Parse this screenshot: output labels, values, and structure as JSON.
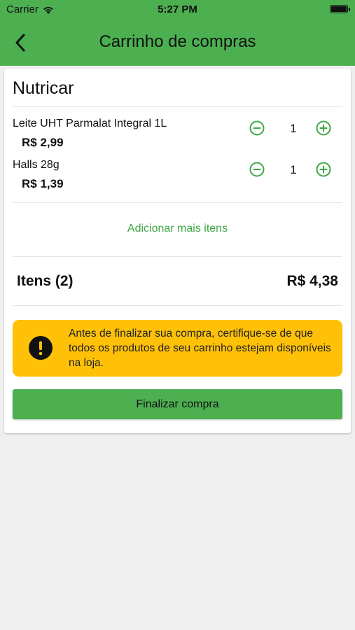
{
  "status_bar": {
    "carrier": "Carrier",
    "time": "5:27 PM"
  },
  "header": {
    "title": "Carrinho de compras",
    "back_icon": "chevron-left-icon",
    "background": "#4caf50"
  },
  "cart": {
    "store_name": "Nutricar",
    "items": [
      {
        "name": "Leite UHT Parmalat Integral 1L",
        "price": "R$ 2,99",
        "quantity": "1"
      },
      {
        "name": "Halls 28g",
        "price": "R$ 1,39",
        "quantity": "1"
      }
    ],
    "add_more_label": "Adicionar mais itens",
    "summary": {
      "items_label": "Itens (2)",
      "total": "R$ 4,38"
    },
    "warning": {
      "text": "Antes de finalizar sua compra, certifique-se de que todos os produtos de seu carrinho estejam disponíveis na loja.",
      "icon": "exclamation-icon",
      "background": "#ffc107"
    },
    "finalize_label": "Finalizar compra"
  },
  "colors": {
    "accent": "#4caf50",
    "link": "#3fa745",
    "page_background": "#efefef"
  }
}
